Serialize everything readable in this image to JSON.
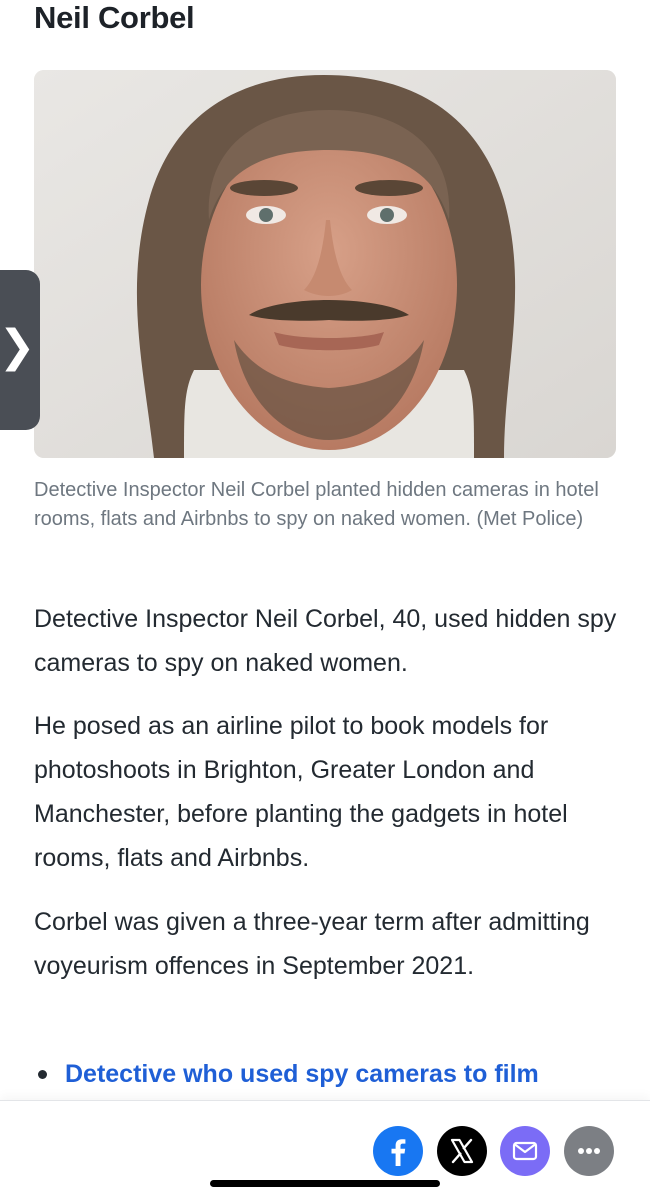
{
  "article": {
    "headline": "Neil Corbel",
    "photo_caption": "Detective Inspector Neil Corbel planted hidden cameras in hotel rooms, flats and Airbnbs to spy on naked women. (Met Police)",
    "paragraphs": [
      "Detective Inspector Neil Corbel, 40, used hidden spy cameras to spy on naked women.",
      "He posed as an airline pilot to book models for photoshoots in Brighton, Greater London and Manchester, before planting the gadgets in hotel rooms, flats and Airbnbs.",
      "Corbel was given a three-year term after admitting voyeurism offences in September 2021."
    ],
    "related_links": [
      "Detective who used spy cameras to film"
    ]
  },
  "side_tab": {
    "icon": "chevron-right-icon",
    "glyph": "❯"
  },
  "share_bar": {
    "buttons": [
      {
        "icon": "facebook-icon",
        "color": "#1877f2"
      },
      {
        "icon": "x-icon",
        "color": "#000000"
      },
      {
        "icon": "mail-icon",
        "color": "#7b6cf6"
      },
      {
        "icon": "more-icon",
        "color": "#7c7f84"
      }
    ]
  },
  "colors": {
    "text": "#232a31",
    "caption": "#6e7780",
    "link": "#1f5fd6"
  }
}
